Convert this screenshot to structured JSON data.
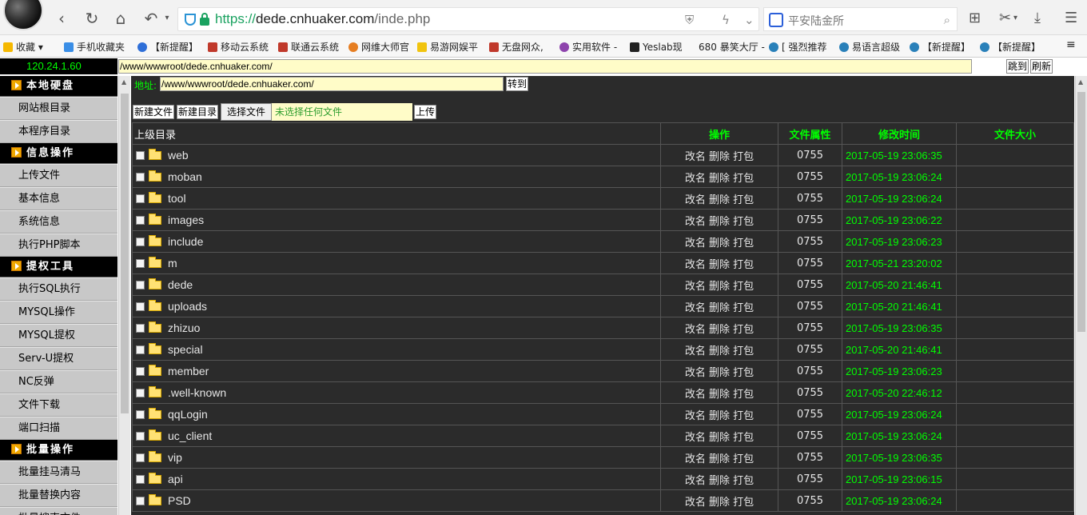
{
  "browser": {
    "url": {
      "protocol": "https://",
      "host": "dede.cnhuaker.com",
      "path": "/inde.php"
    },
    "search_placeholder": "平安陆金所"
  },
  "bookmarks": [
    {
      "label": "收藏",
      "color": "#f5b800"
    },
    {
      "label": "手机收藏夹",
      "color": "#3a8ee6"
    },
    {
      "label": "【新提醒】",
      "color": "#2f6fd8"
    },
    {
      "label": "移动云系统",
      "color": "#c0392b"
    },
    {
      "label": "联通云系统",
      "color": "#c0392b"
    },
    {
      "label": "网维大师官",
      "color": "#e67e22"
    },
    {
      "label": "易游网娱平",
      "color": "#f1c40f"
    },
    {
      "label": "无盘网众,",
      "color": "#c0392b"
    },
    {
      "label": "实用软件 -",
      "color": "#8e44ad"
    },
    {
      "label": "Yeslab现",
      "color": "#222222"
    },
    {
      "label": "680 暴笑大厅 -",
      "color": "#c0392b"
    },
    {
      "label": "[ 强烈推荐",
      "color": "#2980b9"
    },
    {
      "label": "易语言超级",
      "color": "#2980b9"
    },
    {
      "label": "【新提醒】",
      "color": "#2980b9"
    },
    {
      "label": "【新提醒】",
      "color": "#2980b9"
    }
  ],
  "shell": {
    "ip": "120.24.1.60",
    "top_path": "/www/wwwroot/dede.cnhuaker.com/",
    "jump_label": "跳到",
    "refresh_label": "刷新",
    "address_label": "地址:",
    "address_value": "/www/wwwroot/dede.cnhuaker.com/",
    "goto_label": "转到",
    "new_file_label": "新建文件",
    "new_dir_label": "新建目录",
    "choose_file_label": "选择文件",
    "no_file_label": "未选择任何文件",
    "upload_label": "上传"
  },
  "sidebar": {
    "sections": [
      {
        "title": "本地硬盘",
        "items": [
          "网站根目录",
          "本程序目录"
        ]
      },
      {
        "title": "信息操作",
        "items": [
          "上传文件",
          "基本信息",
          "系统信息",
          "执行PHP脚本"
        ]
      },
      {
        "title": "提权工具",
        "items": [
          "执行SQL执行",
          "MYSQL操作",
          "MYSQL提权",
          "Serv-U提权",
          "NC反弹",
          "文件下载",
          "端口扫描"
        ]
      },
      {
        "title": "批量操作",
        "items": [
          "批量挂马清马",
          "批量替换内容",
          "批量搜索文件"
        ]
      }
    ]
  },
  "table": {
    "headers": [
      "上级目录",
      "操作",
      "文件属性",
      "修改时间",
      "文件大小"
    ],
    "ops_label": "改名 删除 打包",
    "rows": [
      {
        "name": "web",
        "perm": "0755",
        "mtime": "2017-05-19 23:06:35"
      },
      {
        "name": "moban",
        "perm": "0755",
        "mtime": "2017-05-19 23:06:24"
      },
      {
        "name": "tool",
        "perm": "0755",
        "mtime": "2017-05-19 23:06:24"
      },
      {
        "name": "images",
        "perm": "0755",
        "mtime": "2017-05-19 23:06:22"
      },
      {
        "name": "include",
        "perm": "0755",
        "mtime": "2017-05-19 23:06:23"
      },
      {
        "name": "m",
        "perm": "0755",
        "mtime": "2017-05-21 23:20:02"
      },
      {
        "name": "dede",
        "perm": "0755",
        "mtime": "2017-05-20 21:46:41"
      },
      {
        "name": "uploads",
        "perm": "0755",
        "mtime": "2017-05-20 21:46:41"
      },
      {
        "name": "zhizuo",
        "perm": "0755",
        "mtime": "2017-05-19 23:06:35"
      },
      {
        "name": "special",
        "perm": "0755",
        "mtime": "2017-05-20 21:46:41"
      },
      {
        "name": "member",
        "perm": "0755",
        "mtime": "2017-05-19 23:06:23"
      },
      {
        "name": ".well-known",
        "perm": "0755",
        "mtime": "2017-05-20 22:46:12"
      },
      {
        "name": "qqLogin",
        "perm": "0755",
        "mtime": "2017-05-19 23:06:24"
      },
      {
        "name": "uc_client",
        "perm": "0755",
        "mtime": "2017-05-19 23:06:24"
      },
      {
        "name": "vip",
        "perm": "0755",
        "mtime": "2017-05-19 23:06:35"
      },
      {
        "name": "api",
        "perm": "0755",
        "mtime": "2017-05-19 23:06:15"
      },
      {
        "name": "PSD",
        "perm": "0755",
        "mtime": "2017-05-19 23:06:24"
      }
    ]
  }
}
